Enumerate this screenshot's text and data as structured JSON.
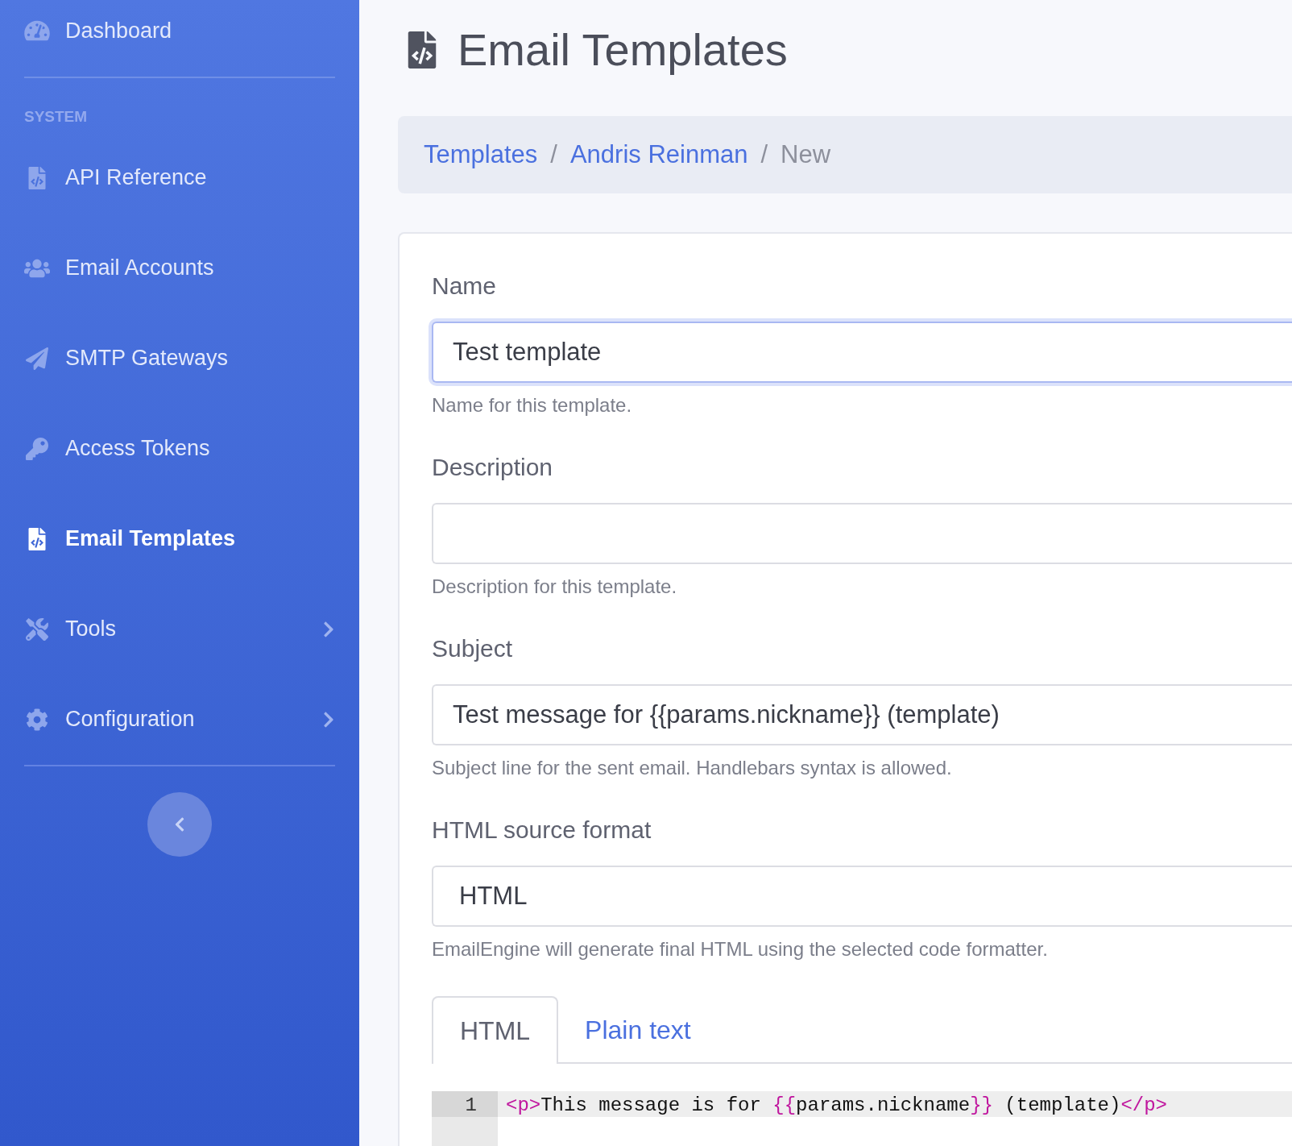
{
  "sidebar": {
    "top_items": [
      {
        "label": "Dashboard",
        "selected": false,
        "has_submenu": false
      }
    ],
    "section_heading": "SYSTEM",
    "items": [
      {
        "label": "API Reference",
        "selected": false,
        "has_submenu": false
      },
      {
        "label": "Email Accounts",
        "selected": false,
        "has_submenu": false
      },
      {
        "label": "SMTP Gateways",
        "selected": false,
        "has_submenu": false
      },
      {
        "label": "Access Tokens",
        "selected": false,
        "has_submenu": false
      },
      {
        "label": "Email Templates",
        "selected": true,
        "has_submenu": false
      },
      {
        "label": "Tools",
        "selected": false,
        "has_submenu": true
      },
      {
        "label": "Configuration",
        "selected": false,
        "has_submenu": true
      }
    ]
  },
  "page": {
    "title": "Email Templates"
  },
  "breadcrumb": [
    {
      "label": "Templates",
      "link": true
    },
    {
      "separator": "/",
      "label": "Andris Reinman",
      "link": true
    },
    {
      "separator": "/",
      "label": "New",
      "link": false
    }
  ],
  "form": {
    "fields": [
      {
        "label": "Name",
        "kind": "input",
        "value": "Test template",
        "focused": true,
        "help": "Name for this template."
      },
      {
        "label": "Description",
        "kind": "input",
        "focused": false,
        "help": "Description for this template."
      },
      {
        "label": "Subject",
        "kind": "input",
        "value": "Test message for {{params.nickname}} (template)",
        "focused": false,
        "help": "Subject line for the sent email. Handlebars syntax is allowed."
      },
      {
        "label": "HTML source format",
        "kind": "select",
        "value": "HTML",
        "focused": false,
        "help": "EmailEngine will generate final HTML using the selected code formatter."
      }
    ],
    "tabs": [
      {
        "label": "HTML",
        "selected": true
      },
      {
        "label": "Plain text",
        "selected": false
      }
    ],
    "code": {
      "lines": [
        {
          "number": "1",
          "tokens": [
            {
              "kind": "tag",
              "text": "<p>"
            },
            {
              "kind": "text",
              "text": "This message is for "
            },
            {
              "kind": "var",
              "text": "{{"
            },
            {
              "kind": "text",
              "text": "params.nickname"
            },
            {
              "kind": "var",
              "text": "}}"
            },
            {
              "kind": "text",
              "text": " (template)"
            },
            {
              "kind": "tag",
              "text": "</p>"
            }
          ]
        }
      ]
    }
  }
}
